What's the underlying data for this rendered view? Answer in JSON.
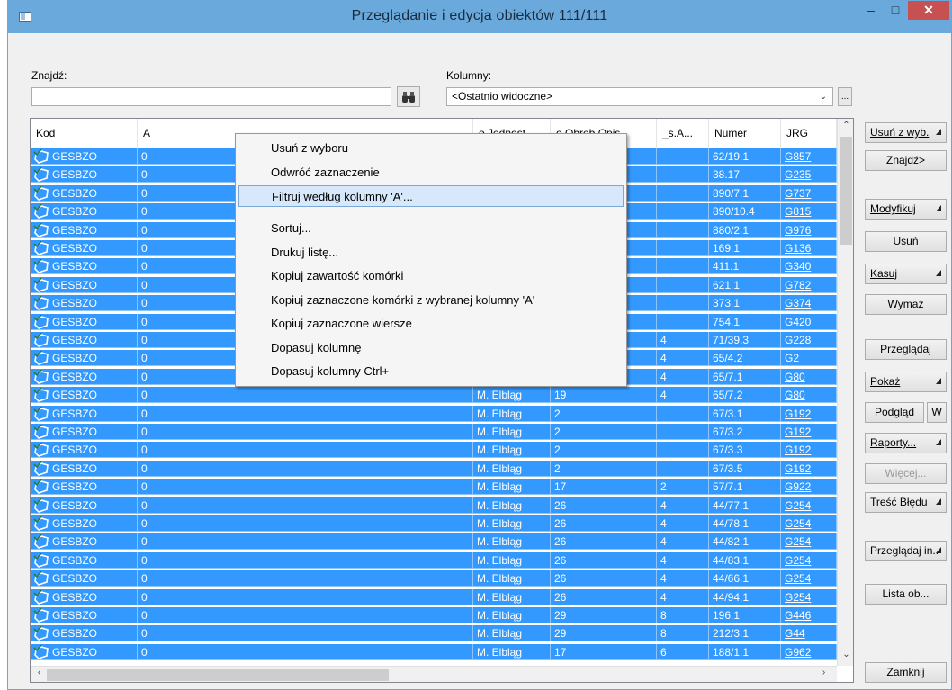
{
  "window": {
    "title": "Przeglądanie i edycja obiektów  111/111",
    "minimize": "–",
    "maximize": "□",
    "close": "✕"
  },
  "search": {
    "label": "Znajdź:",
    "value": "",
    "find_icon": "binoculars-icon"
  },
  "columns": {
    "label": "Kolumny:",
    "selected": "<Ostatnio widoczne>",
    "more_button": "..."
  },
  "grid": {
    "headers": [
      "Kod",
      "A",
      "o Jednost...",
      "o Obreb Opis",
      "_s.A...",
      "Numer",
      "JRG"
    ],
    "rows": [
      {
        "kod": "GESBZO",
        "a": "0",
        "jed": "",
        "obr": "",
        "sa": "",
        "numer": "62/19.1",
        "jrg": "G857"
      },
      {
        "kod": "GESBZO",
        "a": "0",
        "jed": "",
        "obr": "",
        "sa": "",
        "numer": "38.17",
        "jrg": "G235"
      },
      {
        "kod": "GESBZO",
        "a": "0",
        "jed": "",
        "obr": "",
        "sa": "",
        "numer": "890/7.1",
        "jrg": "G737"
      },
      {
        "kod": "GESBZO",
        "a": "0",
        "jed": "",
        "obr": "",
        "sa": "",
        "numer": "890/10.4",
        "jrg": "G815"
      },
      {
        "kod": "GESBZO",
        "a": "0",
        "jed": "",
        "obr": "",
        "sa": "",
        "numer": "880/2.1",
        "jrg": "G976"
      },
      {
        "kod": "GESBZO",
        "a": "0",
        "jed": "",
        "obr": "",
        "sa": "",
        "numer": "169.1",
        "jrg": "G136"
      },
      {
        "kod": "GESBZO",
        "a": "0",
        "jed": "",
        "obr": "",
        "sa": "",
        "numer": "411.1",
        "jrg": "G340"
      },
      {
        "kod": "GESBZO",
        "a": "0",
        "jed": "",
        "obr": "",
        "sa": "",
        "numer": "621.1",
        "jrg": "G782"
      },
      {
        "kod": "GESBZO",
        "a": "0",
        "jed": "",
        "obr": "",
        "sa": "",
        "numer": "373.1",
        "jrg": "G374"
      },
      {
        "kod": "GESBZO",
        "a": "0",
        "jed": "",
        "obr": "",
        "sa": "",
        "numer": "754.1",
        "jrg": "G420"
      },
      {
        "kod": "GESBZO",
        "a": "0",
        "jed": "",
        "obr": "",
        "sa": "4",
        "numer": "71/39.3",
        "jrg": "G228"
      },
      {
        "kod": "GESBZO",
        "a": "0",
        "jed": "",
        "obr": "",
        "sa": "4",
        "numer": "65/4.2",
        "jrg": "G2"
      },
      {
        "kod": "GESBZO",
        "a": "0",
        "jed": "",
        "obr": "",
        "sa": "4",
        "numer": "65/7.1",
        "jrg": "G80"
      },
      {
        "kod": "GESBZO",
        "a": "0",
        "jed": "M. Elbląg",
        "obr": "19",
        "sa": "4",
        "numer": "65/7.2",
        "jrg": "G80"
      },
      {
        "kod": "GESBZO",
        "a": "0",
        "jed": "M. Elbląg",
        "obr": "2",
        "sa": "",
        "numer": "67/3.1",
        "jrg": "G192"
      },
      {
        "kod": "GESBZO",
        "a": "0",
        "jed": "M. Elbląg",
        "obr": "2",
        "sa": "",
        "numer": "67/3.2",
        "jrg": "G192"
      },
      {
        "kod": "GESBZO",
        "a": "0",
        "jed": "M. Elbląg",
        "obr": "2",
        "sa": "",
        "numer": "67/3.3",
        "jrg": "G192"
      },
      {
        "kod": "GESBZO",
        "a": "0",
        "jed": "M. Elbląg",
        "obr": "2",
        "sa": "",
        "numer": "67/3.5",
        "jrg": "G192"
      },
      {
        "kod": "GESBZO",
        "a": "0",
        "jed": "M. Elbląg",
        "obr": "17",
        "sa": "2",
        "numer": "57/7.1",
        "jrg": "G922"
      },
      {
        "kod": "GESBZO",
        "a": "0",
        "jed": "M. Elbląg",
        "obr": "26",
        "sa": "4",
        "numer": "44/77.1",
        "jrg": "G254"
      },
      {
        "kod": "GESBZO",
        "a": "0",
        "jed": "M. Elbląg",
        "obr": "26",
        "sa": "4",
        "numer": "44/78.1",
        "jrg": "G254"
      },
      {
        "kod": "GESBZO",
        "a": "0",
        "jed": "M. Elbląg",
        "obr": "26",
        "sa": "4",
        "numer": "44/82.1",
        "jrg": "G254"
      },
      {
        "kod": "GESBZO",
        "a": "0",
        "jed": "M. Elbląg",
        "obr": "26",
        "sa": "4",
        "numer": "44/83.1",
        "jrg": "G254"
      },
      {
        "kod": "GESBZO",
        "a": "0",
        "jed": "M. Elbląg",
        "obr": "26",
        "sa": "4",
        "numer": "44/66.1",
        "jrg": "G254"
      },
      {
        "kod": "GESBZO",
        "a": "0",
        "jed": "M. Elbląg",
        "obr": "26",
        "sa": "4",
        "numer": "44/94.1",
        "jrg": "G254"
      },
      {
        "kod": "GESBZO",
        "a": "0",
        "jed": "M. Elbląg",
        "obr": "29",
        "sa": "8",
        "numer": "196.1",
        "jrg": "G446"
      },
      {
        "kod": "GESBZO",
        "a": "0",
        "jed": "M. Elbląg",
        "obr": "29",
        "sa": "8",
        "numer": "212/3.1",
        "jrg": "G44"
      },
      {
        "kod": "GESBZO",
        "a": "0",
        "jed": "M. Elbląg",
        "obr": "17",
        "sa": "6",
        "numer": "188/1.1",
        "jrg": "G962"
      }
    ]
  },
  "context_menu": {
    "items": [
      "Usuń z wyboru",
      "Odwróć zaznaczenie",
      "Filtruj według kolumny 'A'...",
      "Sortuj...",
      "Drukuj listę...",
      "Kopiuj zawartość komórki",
      "Kopiuj zaznaczone komórki z wybranej kolumny 'A'",
      "Kopiuj zaznaczone wiersze",
      "Dopasuj kolumnę",
      "Dopasuj kolumny   Ctrl+"
    ],
    "highlighted_index": 2
  },
  "side_buttons": {
    "usun_z_wyb": "Usuń z wyb.",
    "znajdz": "Znajdź>",
    "modyfikuj": "Modyfikuj",
    "usun": "Usuń",
    "kasuj": "Kasuj",
    "wymaz": "Wymaż",
    "przegladaj": "Przeglądaj",
    "pokaz": "Pokaż",
    "podglad": "Podgląd",
    "w": "W",
    "raporty": "Raporty...",
    "wiecej": "Więcej...",
    "tresc_bledu": "Treść Błędu",
    "przegladaj_in": "Przeglądaj in..",
    "lista_ob": "Lista ob...",
    "zamknij": "Zamknij"
  },
  "colors": {
    "selection": "#3399ff",
    "titlebar": "#6aa9dc",
    "close": "#c75050"
  }
}
